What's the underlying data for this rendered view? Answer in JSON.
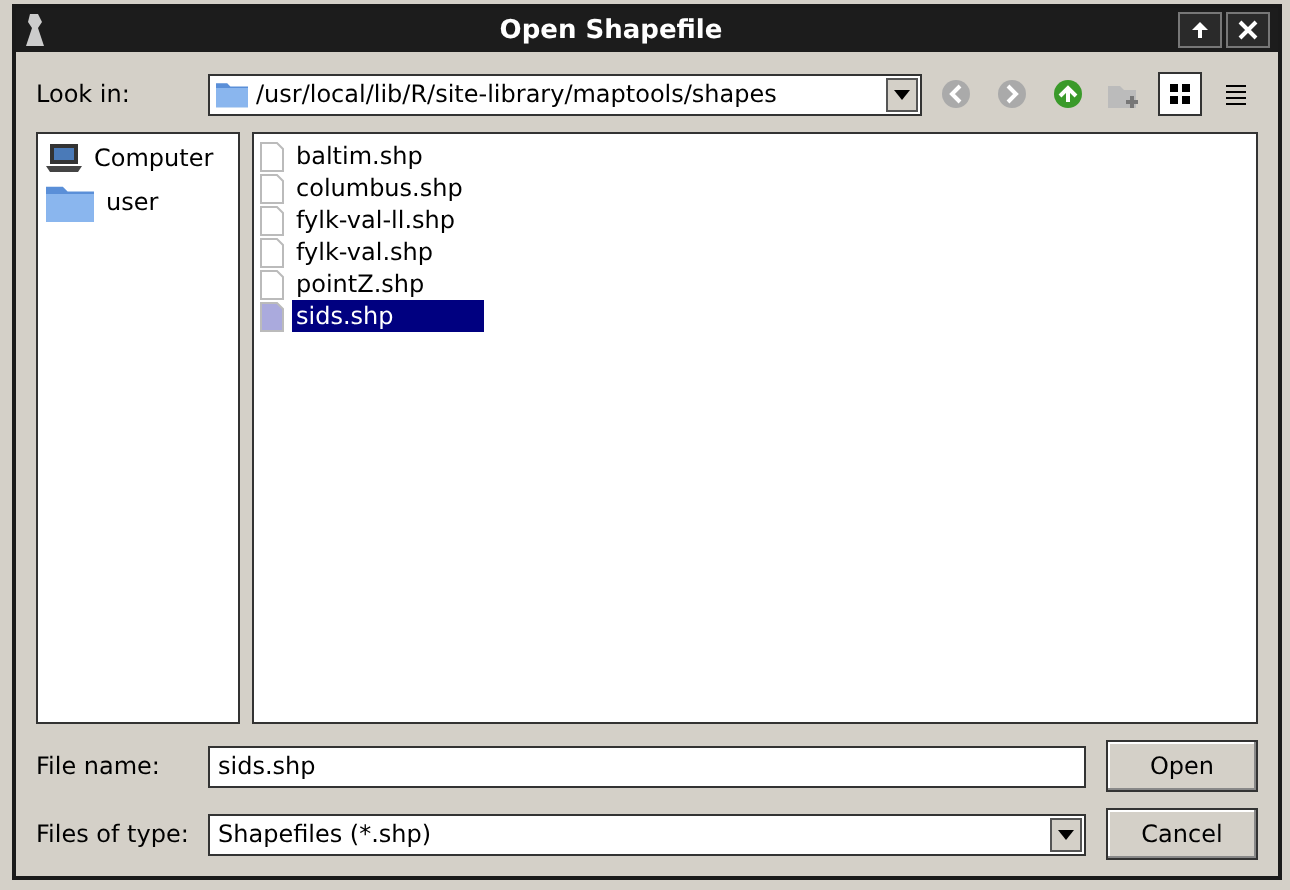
{
  "window": {
    "title": "Open Shapefile"
  },
  "look_in": {
    "label": "Look in:",
    "path": "/usr/local/lib/R/site-library/maptools/shapes"
  },
  "toolbar": [
    {
      "kind": "back",
      "disabled": true
    },
    {
      "kind": "forward",
      "disabled": true
    },
    {
      "kind": "up",
      "disabled": false
    },
    {
      "kind": "new-folder",
      "disabled": true
    },
    {
      "kind": "icons-view",
      "selected": true
    },
    {
      "kind": "list-view",
      "selected": false
    }
  ],
  "places": [
    {
      "kind": "computer",
      "label": "Computer"
    },
    {
      "kind": "folder",
      "label": "user"
    }
  ],
  "files": [
    {
      "name": "baltim.shp",
      "selected": false
    },
    {
      "name": "columbus.shp",
      "selected": false
    },
    {
      "name": "fylk-val-ll.shp",
      "selected": false
    },
    {
      "name": "fylk-val.shp",
      "selected": false
    },
    {
      "name": "pointZ.shp",
      "selected": false
    },
    {
      "name": "sids.shp",
      "selected": true
    }
  ],
  "file_name": {
    "label": "File name:",
    "value": "sids.shp"
  },
  "file_type": {
    "label": "Files of type:",
    "value": "Shapefiles (*.shp)"
  },
  "buttons": [
    {
      "label": "Open"
    },
    {
      "label": "Cancel"
    }
  ]
}
